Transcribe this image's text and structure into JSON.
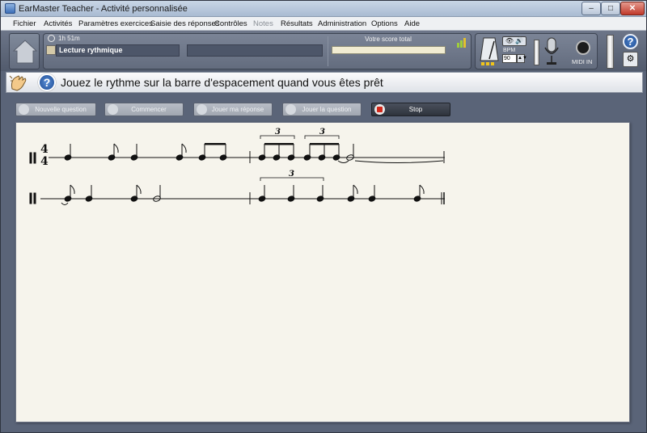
{
  "window": {
    "title": "EarMaster Teacher - Activité personnalisée",
    "min": "–",
    "max": "□",
    "close": "✕"
  },
  "menu": [
    {
      "label": "Fichier",
      "enabled": true
    },
    {
      "label": "Activités",
      "enabled": true
    },
    {
      "label": "Paramètres exercices",
      "enabled": true
    },
    {
      "label": "Saisie des réponses",
      "enabled": true
    },
    {
      "label": "Contrôles",
      "enabled": true
    },
    {
      "label": "Notes",
      "enabled": false
    },
    {
      "label": "Résultats",
      "enabled": true
    },
    {
      "label": "Administration",
      "enabled": true
    },
    {
      "label": "Options",
      "enabled": true
    },
    {
      "label": "Aide",
      "enabled": true
    }
  ],
  "status": {
    "time": "1h 51m",
    "exercise": "Lecture rythmique",
    "score_label": "Votre score total"
  },
  "metronome": {
    "eye": "👁 🔊",
    "bpm_label": "BPM",
    "bpm_value": "90",
    "spin": "▲▼"
  },
  "midi": {
    "label": "MIDI IN"
  },
  "help": {
    "label": "?",
    "settings": "⚙"
  },
  "instruction": "Jouez le rythme sur la barre d'espacement quand vous êtes prêt",
  "buttons": {
    "new_question": "Nouvelle question",
    "start": "Commencer",
    "play_answer": "Jouer ma réponse",
    "play_question": "Jouer la question",
    "stop": "Stop"
  },
  "score": {
    "time_signature": [
      "4",
      "4"
    ],
    "tuplet_number": "3"
  }
}
